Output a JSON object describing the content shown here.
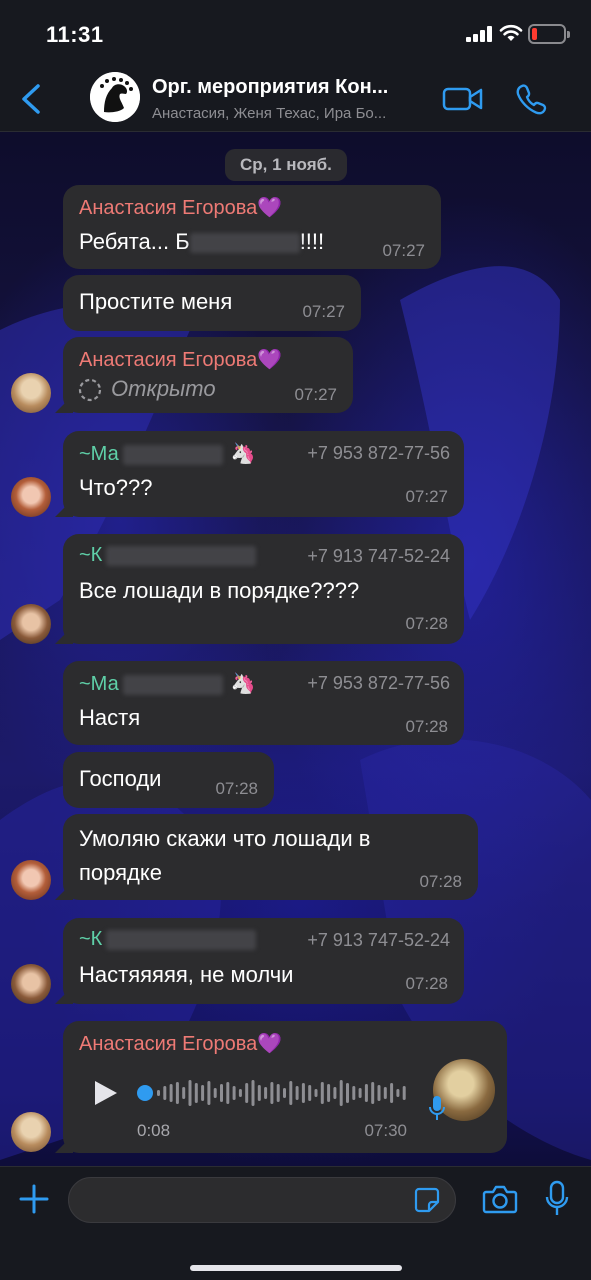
{
  "status_bar": {
    "time": "11:31"
  },
  "header": {
    "title": "Орг. мероприятия Кон...",
    "subtitle": "Анастасия, Женя Техас, Ира Бо..."
  },
  "date_label": "Ср, 1 нояб.",
  "messages": [
    {
      "sender": "Анастасия Егорова💜",
      "text_start": "Ребята... Б",
      "text_end": "!!!!",
      "time": "07:27"
    },
    {
      "text": "Простите меня",
      "time": "07:27"
    },
    {
      "sender": "Анастасия Егорова💜",
      "text": "Открыто",
      "time": "07:27"
    },
    {
      "sender": "~Ма",
      "emoji": "🦄",
      "phone": "+7 953 872-77-56",
      "text": "Что???",
      "time": "07:27"
    },
    {
      "sender": "~К",
      "phone": "+7 913 747-52-24",
      "text": "Все лошади в порядке????",
      "time": "07:28"
    },
    {
      "sender": "~Ма",
      "emoji": "🦄",
      "phone": "+7 953 872-77-56",
      "text": "Настя",
      "time": "07:28"
    },
    {
      "text": "Господи",
      "time": "07:28"
    },
    {
      "text": "Умоляю скажи что лошади в порядке",
      "time": "07:28"
    },
    {
      "sender": "~К",
      "phone": "+7 913 747-52-24",
      "text": "Настяяяяя, не молчи",
      "time": "07:28"
    },
    {
      "sender": "Анастасия Егорова💜",
      "voice_duration": "0:08",
      "time": "07:30"
    }
  ],
  "input": {
    "placeholder": "",
    "value": ""
  },
  "icons": {
    "back": "chevron-left-icon",
    "video": "video-camera-icon",
    "call": "phone-icon",
    "plus": "plus-icon",
    "sticker": "sticker-icon",
    "camera": "camera-icon",
    "mic": "microphone-icon",
    "play": "play-icon"
  },
  "colors": {
    "accent": "#2f9bf0",
    "sender_red": "#ee7a75",
    "sender_green": "#5fd0a8",
    "bubble": "#2c2c2e",
    "battery_low": "#ff3b30"
  }
}
